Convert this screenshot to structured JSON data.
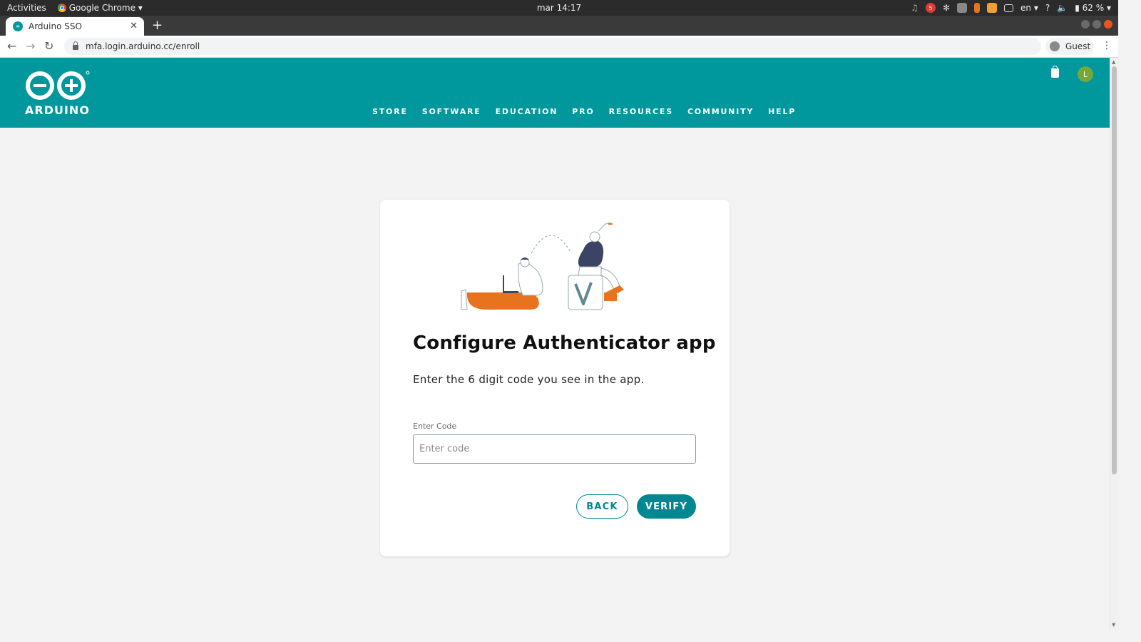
{
  "os": {
    "activities": "Activities",
    "app_name": "Google Chrome",
    "clock": "mar 14:17",
    "notification_count": "5",
    "lang": "en",
    "battery": "62 %"
  },
  "browser": {
    "tab_title": "Arduino SSO",
    "url": "mfa.login.arduino.cc/enroll",
    "profile": "Guest"
  },
  "header": {
    "logo_text": "ARDUINO",
    "nav": [
      "STORE",
      "SOFTWARE",
      "EDUCATION",
      "PRO",
      "RESOURCES",
      "COMMUNITY",
      "HELP"
    ],
    "user_initial": "L"
  },
  "card": {
    "title": "Configure Authenticator app",
    "subtitle": "Enter the 6 digit code you see in the app.",
    "field_label": "Enter Code",
    "field_placeholder": "Enter code",
    "field_value": "",
    "back_label": "BACK",
    "verify_label": "VERIFY"
  },
  "colors": {
    "brand": "#00979d",
    "button": "#00878f",
    "accent": "#e8731f",
    "navy": "#3b4464"
  }
}
